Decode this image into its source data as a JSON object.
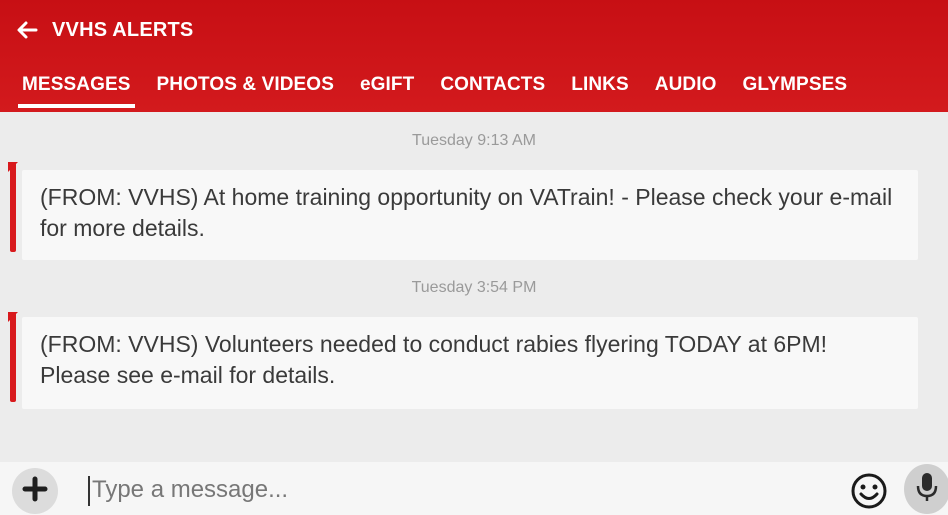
{
  "header": {
    "title": "VVHS ALERTS",
    "back_icon": "back-arrow-icon"
  },
  "tabs": [
    {
      "label": "MESSAGES",
      "active": true
    },
    {
      "label": "PHOTOS & VIDEOS",
      "active": false
    },
    {
      "label": "eGIFT",
      "active": false
    },
    {
      "label": "CONTACTS",
      "active": false
    },
    {
      "label": "LINKS",
      "active": false
    },
    {
      "label": "AUDIO",
      "active": false
    },
    {
      "label": "GLYMPSES",
      "active": false
    }
  ],
  "messages": [
    {
      "timestamp": "Tuesday 9:13 AM",
      "text": "(FROM: VVHS) At home training opportunity on VATrain! - Please check your e-mail for more details."
    },
    {
      "timestamp": "Tuesday 3:54 PM",
      "text": "(FROM: VVHS) Volunteers needed to conduct rabies flyering TODAY at 6PM! Please see e-mail for details."
    }
  ],
  "compose": {
    "placeholder": "Type a message...",
    "add_icon": "plus-icon",
    "emoji_icon": "smiley-icon",
    "mic_icon": "microphone-icon"
  },
  "colors": {
    "accent": "#d31a1d",
    "background": "#ececec",
    "bubble": "#f8f8f8"
  }
}
